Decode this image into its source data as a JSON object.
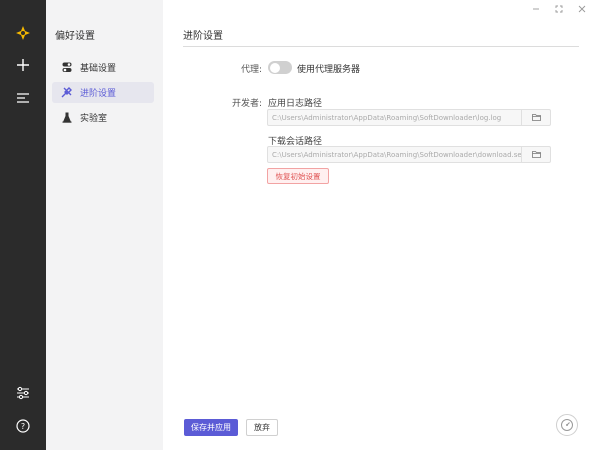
{
  "app": {
    "rail_icons": [
      "app-logo-icon",
      "plus-icon",
      "menu-icon",
      "sliders-icon",
      "help-icon"
    ]
  },
  "settings_nav": {
    "title": "偏好设置",
    "items": [
      {
        "label": "基础设置",
        "icon": "toggle-icon",
        "active": false
      },
      {
        "label": "进阶设置",
        "icon": "wrench-icon",
        "active": true
      },
      {
        "label": "实验室",
        "icon": "flask-icon",
        "active": false
      }
    ]
  },
  "page": {
    "title": "进阶设置",
    "proxy": {
      "label": "代理:",
      "toggle_label": "使用代理服务器",
      "enabled": false
    },
    "developer": {
      "label": "开发者:",
      "log_path_title": "应用日志路径",
      "log_path_value": "C:\\Users\\Administrator\\AppData\\Roaming\\SoftDownloader\\log.log",
      "session_path_title": "下载会话路径",
      "session_path_value": "C:\\Users\\Administrator\\AppData\\Roaming\\SoftDownloader\\download.sess",
      "reset_label": "恢复初始设置"
    }
  },
  "footer": {
    "save_label": "保存并应用",
    "discard_label": "放弃"
  },
  "colors": {
    "rail_bg": "#2b2b2b",
    "nav_bg": "#f3f3f4",
    "accent": "#5b5bd6",
    "logo": "#f5b800",
    "danger": "#e05555"
  }
}
